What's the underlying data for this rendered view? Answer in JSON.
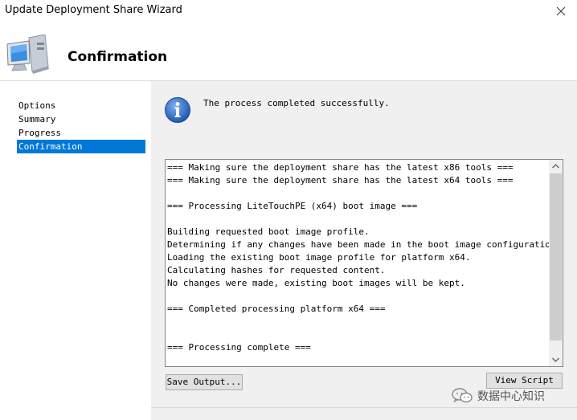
{
  "window": {
    "title": "Update Deployment Share Wizard"
  },
  "header": {
    "title": "Confirmation"
  },
  "sidebar": {
    "items": [
      {
        "label": "Options",
        "selected": false
      },
      {
        "label": "Summary",
        "selected": false
      },
      {
        "label": "Progress",
        "selected": false
      },
      {
        "label": "Confirmation",
        "selected": true
      }
    ]
  },
  "main": {
    "status_text": "The process completed successfully.",
    "log_lines": [
      "=== Making sure the deployment share has the latest x86 tools ===",
      "=== Making sure the deployment share has the latest x64 tools ===",
      "",
      "=== Processing LiteTouchPE (x64) boot image ===",
      "",
      "Building requested boot image profile.",
      "Determining if any changes have been made in the boot image configuration.",
      "Loading the existing boot image profile for platform x64.",
      "Calculating hashes for requested content.",
      "No changes were made, existing boot images will be kept.",
      "",
      "=== Completed processing platform x64 ===",
      "",
      "",
      "=== Processing complete ==="
    ],
    "save_button": "Save Output...",
    "view_button": "View Script"
  },
  "watermark": {
    "text": "数据中心知识"
  },
  "colors": {
    "selection": "#0078d7",
    "panel": "#f0f0f0",
    "info_icon": "#2a64b8"
  },
  "icons": [
    "close-icon",
    "computer-icon",
    "info-icon",
    "scroll-up-arrow-icon",
    "scroll-down-arrow-icon",
    "wechat-icon"
  ]
}
